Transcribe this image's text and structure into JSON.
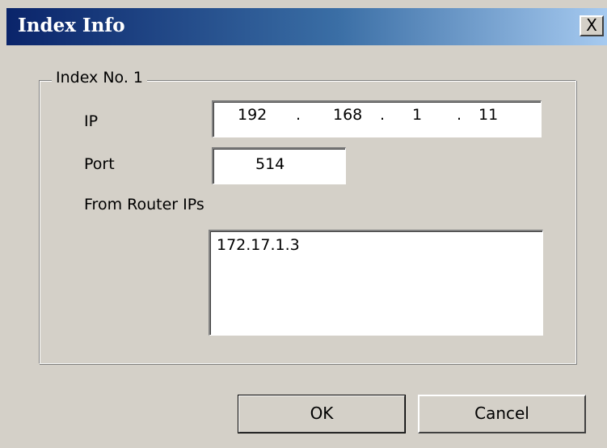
{
  "window": {
    "title": "Index Info",
    "close_label": "X"
  },
  "group": {
    "label": "Index No. 1"
  },
  "ip": {
    "label": "IP",
    "octets": [
      "192",
      "168",
      "1",
      "11"
    ],
    "separator": "."
  },
  "port": {
    "label": "Port",
    "value": "514"
  },
  "router_ips": {
    "label": "From Router IPs",
    "value": "172.17.1.3"
  },
  "buttons": {
    "ok": "OK",
    "cancel": "Cancel"
  }
}
